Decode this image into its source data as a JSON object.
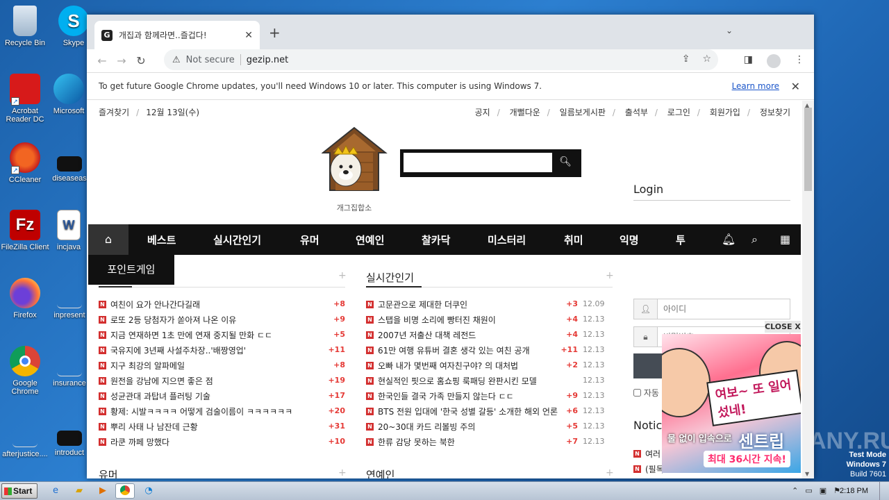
{
  "desktop": {
    "icons": [
      {
        "label": "Recycle Bin",
        "icon": "recycle-bin-icon"
      },
      {
        "label": "Skype",
        "icon": "skype-icon"
      },
      {
        "label": "Acrobat Reader DC",
        "icon": "acrobat-icon"
      },
      {
        "label": "Microsoft",
        "icon": "edge-icon"
      },
      {
        "label": "CCleaner",
        "icon": "ccleaner-icon"
      },
      {
        "label": "diseaseas",
        "icon": "file-icon"
      },
      {
        "label": "FileZilla Client",
        "icon": "filezilla-icon"
      },
      {
        "label": "incjava",
        "icon": "word-icon"
      },
      {
        "label": "Firefox",
        "icon": "firefox-icon"
      },
      {
        "label": "inpresent",
        "icon": "file-icon"
      },
      {
        "label": "Google Chrome",
        "icon": "chrome-icon"
      },
      {
        "label": "insurance",
        "icon": "file-icon"
      },
      {
        "label": "afterjustice....",
        "icon": "file-icon"
      },
      {
        "label": "introduct",
        "icon": "file-icon"
      }
    ],
    "watermark": {
      "line1": "Test Mode",
      "line2": "Windows 7",
      "line3": "Build 7601"
    },
    "anyrun": "ANY.RUN"
  },
  "browser": {
    "tab_title": "개집과 함께라면..즐겁다!",
    "favicon": "G",
    "url_warning": "Not secure",
    "url": "gezip.net",
    "infobar_message": "To get future Google Chrome updates, you'll need Windows 10 or later. This computer is using Windows 7.",
    "infobar_link": "Learn more"
  },
  "site": {
    "top_left": [
      "즐겨찾기",
      "12월 13일(수)"
    ],
    "top_right": [
      "공지",
      "개뻘다운",
      "일름보게시판",
      "출석부",
      "로그인",
      "회원가입",
      "정보찾기"
    ],
    "logo_caption": "개그집합소",
    "search_placeholder": "",
    "nav": [
      "베스트",
      "실시간인기",
      "유머",
      "연예인",
      "찰카닥",
      "미스터리",
      "취미",
      "익명",
      "투"
    ],
    "point_game_tab": "포인트게임",
    "section_left": {
      "title": "",
      "items": [
        {
          "title": "여친이 요가 안나간다길래",
          "count": "+8"
        },
        {
          "title": "로또 2등 당첨자가 쏟아져 나온 이유",
          "count": "+9"
        },
        {
          "title": "지금 연재하면 1초 만에 연재 중지될 만화 ㄷㄷ",
          "count": "+5"
        },
        {
          "title": "국유지에 3년째 사설주차장..'배짱영업'",
          "count": "+11"
        },
        {
          "title": "지구 최강의 알파메일",
          "count": "+8"
        },
        {
          "title": "원전을 강남에 지으면 좋은 점",
          "count": "+19"
        },
        {
          "title": "성균관대 과탑녀 플러팅 기술",
          "count": "+17"
        },
        {
          "title": "황제: 시발ㅋㅋㅋㅋ 어떻게 검술이름이 ㅋㅋㅋㅋㅋㅋ",
          "count": "+20"
        },
        {
          "title": "뿌리 사태 나 남잔데 근황",
          "count": "+31"
        },
        {
          "title": "라쿤 까페 망했다",
          "count": "+10"
        }
      ]
    },
    "section_mid": {
      "title": "실시간인기",
      "items": [
        {
          "title": "고문관으로 제대한 더쿠인",
          "count": "+3",
          "date": "12.09"
        },
        {
          "title": "스탭을 비명 소리에 빵터진 채원이",
          "count": "+4",
          "date": "12.13"
        },
        {
          "title": "2007년 저출산 대책 레전드",
          "count": "+4",
          "date": "12.13"
        },
        {
          "title": "61만 여행 유튜버 결혼 생각 있는 여친 공개",
          "count": "+11",
          "date": "12.13"
        },
        {
          "title": "오빠 내가 몇번째 여자친구야? 의 대처법",
          "count": "+2",
          "date": "12.13"
        },
        {
          "title": "현실적인 핏으로 홈쇼핑 룩패딩 완판시킨 모델",
          "count": "",
          "date": "12.13"
        },
        {
          "title": "한국인들 결국 가족 만들지 않는다 ㄷㄷ",
          "count": "+9",
          "date": "12.13"
        },
        {
          "title": "BTS 전원 입대에 '한국 성별 갈등' 소개한 해외 언론",
          "count": "+6",
          "date": "12.13"
        },
        {
          "title": "20~30대 카드 리볼빙 주의",
          "count": "+5",
          "date": "12.13"
        },
        {
          "title": "한류 감당 못하는 북한",
          "count": "+7",
          "date": "12.13"
        }
      ]
    },
    "bottom_sections": [
      "유머",
      "연예인"
    ],
    "login": {
      "title": "Login",
      "id_placeholder": "아이디",
      "pw_placeholder": "비밀번호",
      "auto_login": "자동",
      "notice": "Notice",
      "notice_items": [
        "여러",
        "(필독"
      ]
    },
    "ad": {
      "close": "CLOSE X",
      "text1": "여보~ 또 일어섰네!",
      "brand": "센트립",
      "text2": "물 없이 입속으로",
      "text3": "최대 36시간 지속!"
    }
  },
  "taskbar": {
    "start": "Start",
    "time": "2:18 PM"
  }
}
